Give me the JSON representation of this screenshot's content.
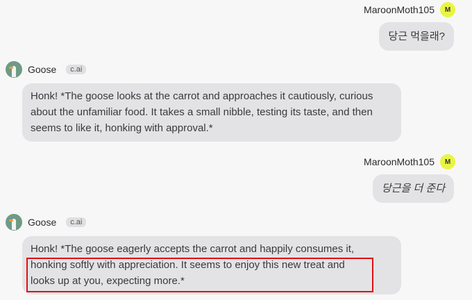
{
  "messages": [
    {
      "sender": "MaroonMoth105",
      "avatar_letter": "M",
      "text": "당근 먹을래?"
    },
    {
      "sender": "Goose",
      "tag": "c.ai",
      "text": "Honk! *The goose looks at the carrot and approaches it cautiously, curious about the unfamiliar food. It takes a small nibble, testing its taste, and then seems to like it, honking with approval.*"
    },
    {
      "sender": "MaroonMoth105",
      "avatar_letter": "M",
      "text": "당근을 더 준다"
    },
    {
      "sender": "Goose",
      "tag": "c.ai",
      "text_line1": "Honk! *The goose eagerly accepts the carrot and happily consumes it,",
      "text_highlight_1": "honking softly with appreciation. It seems to enjoy this new treat and",
      "text_highlight_2": "looks up at you, expecting more.*"
    }
  ],
  "colors": {
    "user_avatar": "#e9f542",
    "bubble": "#e3e3e6",
    "highlight": "#e01010",
    "bot_avatar": "#6f9a86"
  },
  "icons": {
    "user_avatar": "letter-avatar",
    "bot_avatar": "goose-avatar-icon"
  }
}
